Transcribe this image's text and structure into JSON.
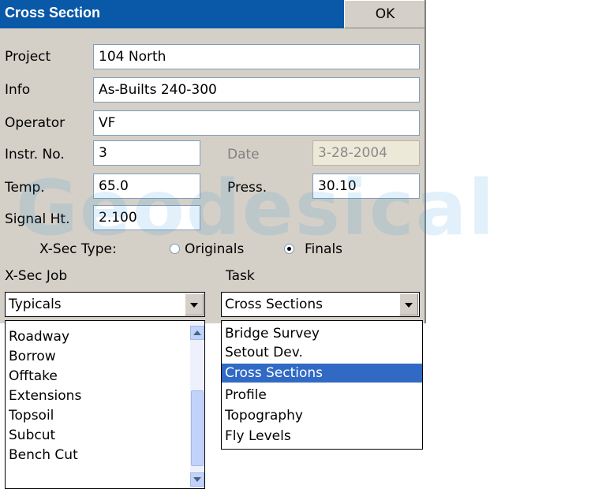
{
  "window": {
    "title": "Cross Section",
    "ok_label": "OK"
  },
  "fields": {
    "project": {
      "label": "Project",
      "value": "104 North"
    },
    "info": {
      "label": "Info",
      "value": "As-Builts 240-300"
    },
    "operator": {
      "label": "Operator",
      "value": "VF"
    },
    "instr_no": {
      "label": "Instr. No.",
      "value": "3"
    },
    "date": {
      "label": "Date",
      "value": "3-28-2004"
    },
    "temp": {
      "label": "Temp.",
      "value": "65.0"
    },
    "press": {
      "label": "Press.",
      "value": "30.10"
    },
    "signal_ht": {
      "label": "Signal Ht.",
      "value": "2.100"
    }
  },
  "xsec_type": {
    "label": "X-Sec Type:",
    "options": [
      "Originals",
      "Finals"
    ],
    "selected": "Finals"
  },
  "xsec_job": {
    "label": "X-Sec Job",
    "value": "Typicals",
    "items": [
      "Roadway",
      "Borrow",
      "Offtake",
      "Extensions",
      "Topsoil",
      "Subcut",
      "Bench Cut"
    ]
  },
  "task": {
    "label": "Task",
    "value": "Cross Sections",
    "items": [
      "Bridge Survey",
      "Setout Dev.",
      "Cross Sections",
      "Profile",
      "Topography",
      "Fly Levels"
    ],
    "selected": "Cross Sections"
  },
  "watermark": "Geodesical",
  "colors": {
    "title_bar": "#0a58a8",
    "dialog_bg": "#d4d0c8",
    "selection": "#316ac5"
  }
}
